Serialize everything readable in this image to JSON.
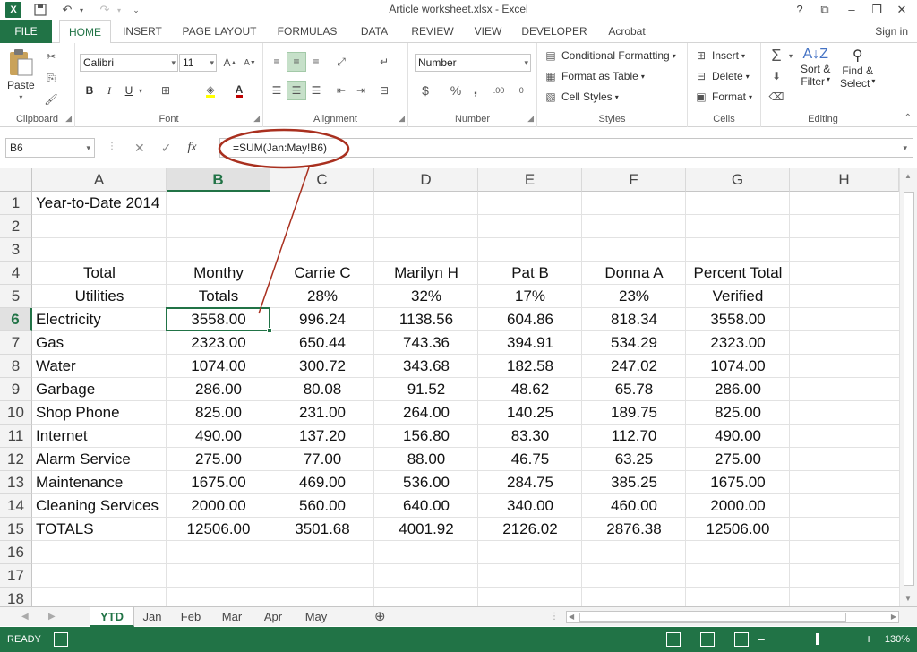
{
  "window": {
    "title": "Article worksheet.xlsx - Excel",
    "app_icon": "X",
    "help": "?",
    "controls": [
      "⧉",
      "–",
      "❐",
      "✕"
    ]
  },
  "qat": {
    "save_icon": "save-icon",
    "undo_icon": "undo-icon",
    "redo_icon": "redo-icon"
  },
  "tabs": [
    "FILE",
    "HOME",
    "INSERT",
    "PAGE LAYOUT",
    "FORMULAS",
    "DATA",
    "REVIEW",
    "VIEW",
    "DEVELOPER",
    "Acrobat"
  ],
  "signin": "Sign in",
  "ribbon": {
    "clipboard": {
      "label": "Clipboard",
      "paste": "Paste"
    },
    "font": {
      "label": "Font",
      "name": "Calibri",
      "size": "11",
      "bold": "B",
      "italic": "I",
      "underline": "U"
    },
    "alignment": {
      "label": "Alignment"
    },
    "number": {
      "label": "Number",
      "format": "Number",
      "currency": "$",
      "percent": "%",
      "comma": ","
    },
    "styles": {
      "label": "Styles",
      "conditional": "Conditional Formatting",
      "table": "Format as Table",
      "cell_styles": "Cell Styles"
    },
    "cells": {
      "label": "Cells",
      "insert": "Insert",
      "delete": "Delete",
      "format": "Format"
    },
    "editing": {
      "label": "Editing",
      "sort_1": "Sort &",
      "sort_2": "Filter",
      "find_1": "Find &",
      "find_2": "Select"
    }
  },
  "formula_bar": {
    "name_box": "B6",
    "formula": "=SUM(Jan:May!B6)",
    "fx": "fx"
  },
  "columns": [
    "A",
    "B",
    "C",
    "D",
    "E",
    "F",
    "G",
    "H"
  ],
  "selected_column": "B",
  "selected_row": "6",
  "rows": [
    {
      "n": "1",
      "a": "Year-to-Date 2014",
      "b": "",
      "c": "",
      "d": "",
      "e": "",
      "f": "",
      "g": ""
    },
    {
      "n": "2",
      "a": "",
      "b": "",
      "c": "",
      "d": "",
      "e": "",
      "f": "",
      "g": ""
    },
    {
      "n": "3",
      "a": "",
      "b": "",
      "c": "",
      "d": "",
      "e": "",
      "f": "",
      "g": ""
    },
    {
      "n": "4",
      "a": "Total",
      "b": "Monthy",
      "c": "Carrie C",
      "d": "Marilyn H",
      "e": "Pat B",
      "f": "Donna A",
      "g": "Percent Total"
    },
    {
      "n": "5",
      "a": "Utilities",
      "b": "Totals",
      "c": "28%",
      "d": "32%",
      "e": "17%",
      "f": "23%",
      "g": "Verified"
    },
    {
      "n": "6",
      "a": "Electricity",
      "b": "3558.00",
      "c": "996.24",
      "d": "1138.56",
      "e": "604.86",
      "f": "818.34",
      "g": "3558.00"
    },
    {
      "n": "7",
      "a": "Gas",
      "b": "2323.00",
      "c": "650.44",
      "d": "743.36",
      "e": "394.91",
      "f": "534.29",
      "g": "2323.00"
    },
    {
      "n": "8",
      "a": "Water",
      "b": "1074.00",
      "c": "300.72",
      "d": "343.68",
      "e": "182.58",
      "f": "247.02",
      "g": "1074.00"
    },
    {
      "n": "9",
      "a": "Garbage",
      "b": "286.00",
      "c": "80.08",
      "d": "91.52",
      "e": "48.62",
      "f": "65.78",
      "g": "286.00"
    },
    {
      "n": "10",
      "a": "Shop Phone",
      "b": "825.00",
      "c": "231.00",
      "d": "264.00",
      "e": "140.25",
      "f": "189.75",
      "g": "825.00"
    },
    {
      "n": "11",
      "a": "Internet",
      "b": "490.00",
      "c": "137.20",
      "d": "156.80",
      "e": "83.30",
      "f": "112.70",
      "g": "490.00"
    },
    {
      "n": "12",
      "a": "Alarm Service",
      "b": "275.00",
      "c": "77.00",
      "d": "88.00",
      "e": "46.75",
      "f": "63.25",
      "g": "275.00"
    },
    {
      "n": "13",
      "a": "Maintenance",
      "b": "1675.00",
      "c": "469.00",
      "d": "536.00",
      "e": "284.75",
      "f": "385.25",
      "g": "1675.00"
    },
    {
      "n": "14",
      "a": "Cleaning Services",
      "b": "2000.00",
      "c": "560.00",
      "d": "640.00",
      "e": "340.00",
      "f": "460.00",
      "g": "2000.00"
    },
    {
      "n": "15",
      "a": "TOTALS",
      "b": "12506.00",
      "c": "3501.68",
      "d": "4001.92",
      "e": "2126.02",
      "f": "2876.38",
      "g": "12506.00"
    },
    {
      "n": "16",
      "a": "",
      "b": "",
      "c": "",
      "d": "",
      "e": "",
      "f": "",
      "g": ""
    },
    {
      "n": "17",
      "a": "",
      "b": "",
      "c": "",
      "d": "",
      "e": "",
      "f": "",
      "g": ""
    },
    {
      "n": "18",
      "a": "",
      "b": "",
      "c": "",
      "d": "",
      "e": "",
      "f": "",
      "g": ""
    }
  ],
  "sheets": [
    "YTD",
    "Jan",
    "Feb",
    "Mar",
    "Apr",
    "May"
  ],
  "active_sheet": "YTD",
  "status": {
    "text": "READY",
    "zoom": "130%",
    "zoom_level": 0.5
  },
  "colors": {
    "accent": "#217346",
    "annotation": "#a9301f"
  }
}
